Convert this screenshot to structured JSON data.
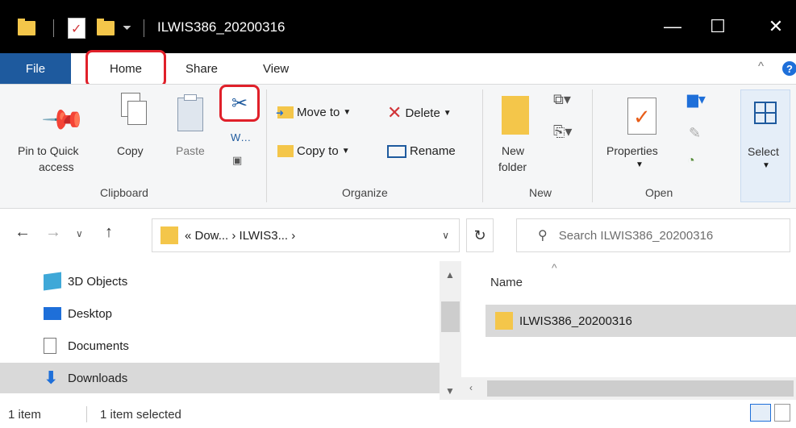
{
  "window": {
    "title": "ILWIS386_20200316",
    "dropdown_glyph": "⏷",
    "minimize": "—",
    "maximize": "☐",
    "close": "✕"
  },
  "ribbon_tabs": {
    "file": "File",
    "home": "Home",
    "share": "Share",
    "view": "View",
    "help": "?"
  },
  "ribbon": {
    "clipboard": {
      "pin_label_1": "Pin to Quick",
      "pin_label_2": "access",
      "copy": "Copy",
      "paste": "Paste",
      "group": "Clipboard"
    },
    "organize": {
      "move_to": "Move to",
      "copy_to": "Copy to",
      "delete": "Delete",
      "rename": "Rename",
      "group": "Organize"
    },
    "new": {
      "new_folder_1": "New",
      "new_folder_2": "folder",
      "group": "New"
    },
    "open": {
      "properties": "Properties",
      "group": "Open"
    },
    "select": {
      "label": "Select"
    }
  },
  "address": {
    "breadcrumb": "« Dow... › ILWIS3... ›",
    "search_placeholder": "Search ILWIS386_20200316"
  },
  "navpane": {
    "items": [
      {
        "label": "3D Objects",
        "icon": "cube-icon"
      },
      {
        "label": "Desktop",
        "icon": "desktop-icon"
      },
      {
        "label": "Documents",
        "icon": "documents-icon"
      },
      {
        "label": "Downloads",
        "icon": "downloads-icon"
      }
    ]
  },
  "filepane": {
    "column_name": "Name",
    "files": [
      {
        "name": "ILWIS386_20200316",
        "icon": "folder-icon"
      }
    ]
  },
  "status": {
    "count": "1 item",
    "selected": "1 item selected"
  },
  "colors": {
    "accent": "#1e5a9e",
    "highlight_outline": "#e0202a",
    "folder": "#f4c64a"
  }
}
